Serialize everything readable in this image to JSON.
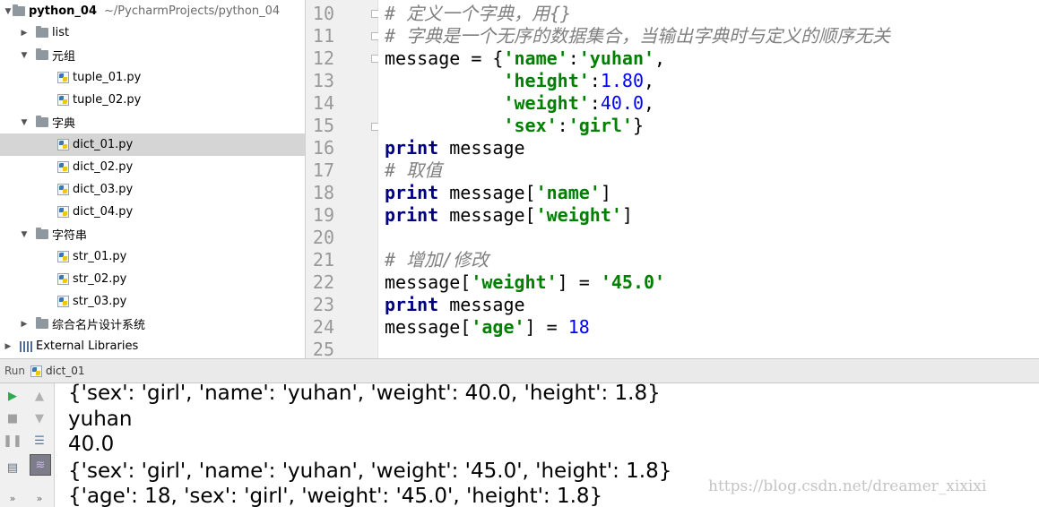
{
  "project": {
    "name": "python_04",
    "path": "~/PycharmProjects/python_04",
    "items": [
      {
        "label": "list",
        "type": "folder",
        "expanded": false
      },
      {
        "label": "元组",
        "type": "folder",
        "expanded": true
      },
      {
        "label": "tuple_01.py",
        "type": "file"
      },
      {
        "label": "tuple_02.py",
        "type": "file"
      },
      {
        "label": "字典",
        "type": "folder",
        "expanded": true
      },
      {
        "label": "dict_01.py",
        "type": "file",
        "selected": true
      },
      {
        "label": "dict_02.py",
        "type": "file"
      },
      {
        "label": "dict_03.py",
        "type": "file"
      },
      {
        "label": "dict_04.py",
        "type": "file"
      },
      {
        "label": "字符串",
        "type": "folder",
        "expanded": true
      },
      {
        "label": "str_01.py",
        "type": "file"
      },
      {
        "label": "str_02.py",
        "type": "file"
      },
      {
        "label": "str_03.py",
        "type": "file"
      },
      {
        "label": "综合名片设计系统",
        "type": "folder",
        "expanded": false
      }
    ],
    "external_libraries": "External Libraries"
  },
  "editor": {
    "line_numbers": [
      "10",
      "11",
      "12",
      "13",
      "14",
      "15",
      "16",
      "17",
      "18",
      "19",
      "20",
      "21",
      "22",
      "23",
      "24",
      "25"
    ],
    "lines": {
      "l10": "# 定义一个字典，用{}",
      "l11": "# 字典是一个无序的数据集合，当输出字典时与定义的顺序无关",
      "l12_a": "message = {",
      "l12_b": "'name'",
      "l12_c": ":",
      "l12_d": "'yuhan'",
      "l12_e": ",",
      "l13_a": "           ",
      "l13_b": "'height'",
      "l13_c": ":",
      "l13_d": "1.80",
      "l13_e": ",",
      "l14_a": "           ",
      "l14_b": "'weight'",
      "l14_c": ":",
      "l14_d": "40.0",
      "l14_e": ",",
      "l15_a": "           ",
      "l15_b": "'sex'",
      "l15_c": ":",
      "l15_d": "'girl'",
      "l15_e": "}",
      "l16_kw": "print",
      "l16_rest": " message",
      "l17": "# 取值",
      "l18_kw": "print",
      "l18_a": " message[",
      "l18_b": "'name'",
      "l18_c": "]",
      "l19_kw": "print",
      "l19_a": " message[",
      "l19_b": "'weight'",
      "l19_c": "]",
      "l21": "# 增加/修改",
      "l22_a": "message[",
      "l22_b": "'weight'",
      "l22_c": "] = ",
      "l22_d": "'45.0'",
      "l23_kw": "print",
      "l23_rest": " message",
      "l24_a": "message[",
      "l24_b": "'age'",
      "l24_c": "] = ",
      "l24_d": "18"
    }
  },
  "run": {
    "label": "Run",
    "config": "dict_01",
    "output": [
      "{'sex': 'girl', 'name': 'yuhan', 'weight': 40.0, 'height': 1.8}",
      "yuhan",
      "40.0",
      "{'sex': 'girl', 'name': 'yuhan', 'weight': '45.0', 'height': 1.8}",
      "{'age': 18, 'sex': 'girl', 'weight': '45.0', 'height': 1.8}"
    ]
  },
  "watermark": "https://blog.csdn.net/dreamer_xixixi",
  "colors": {
    "comment": "#808080",
    "string": "#008000",
    "keyword": "#000080",
    "number": "#0000ff",
    "selection": "#d5d5d5"
  }
}
